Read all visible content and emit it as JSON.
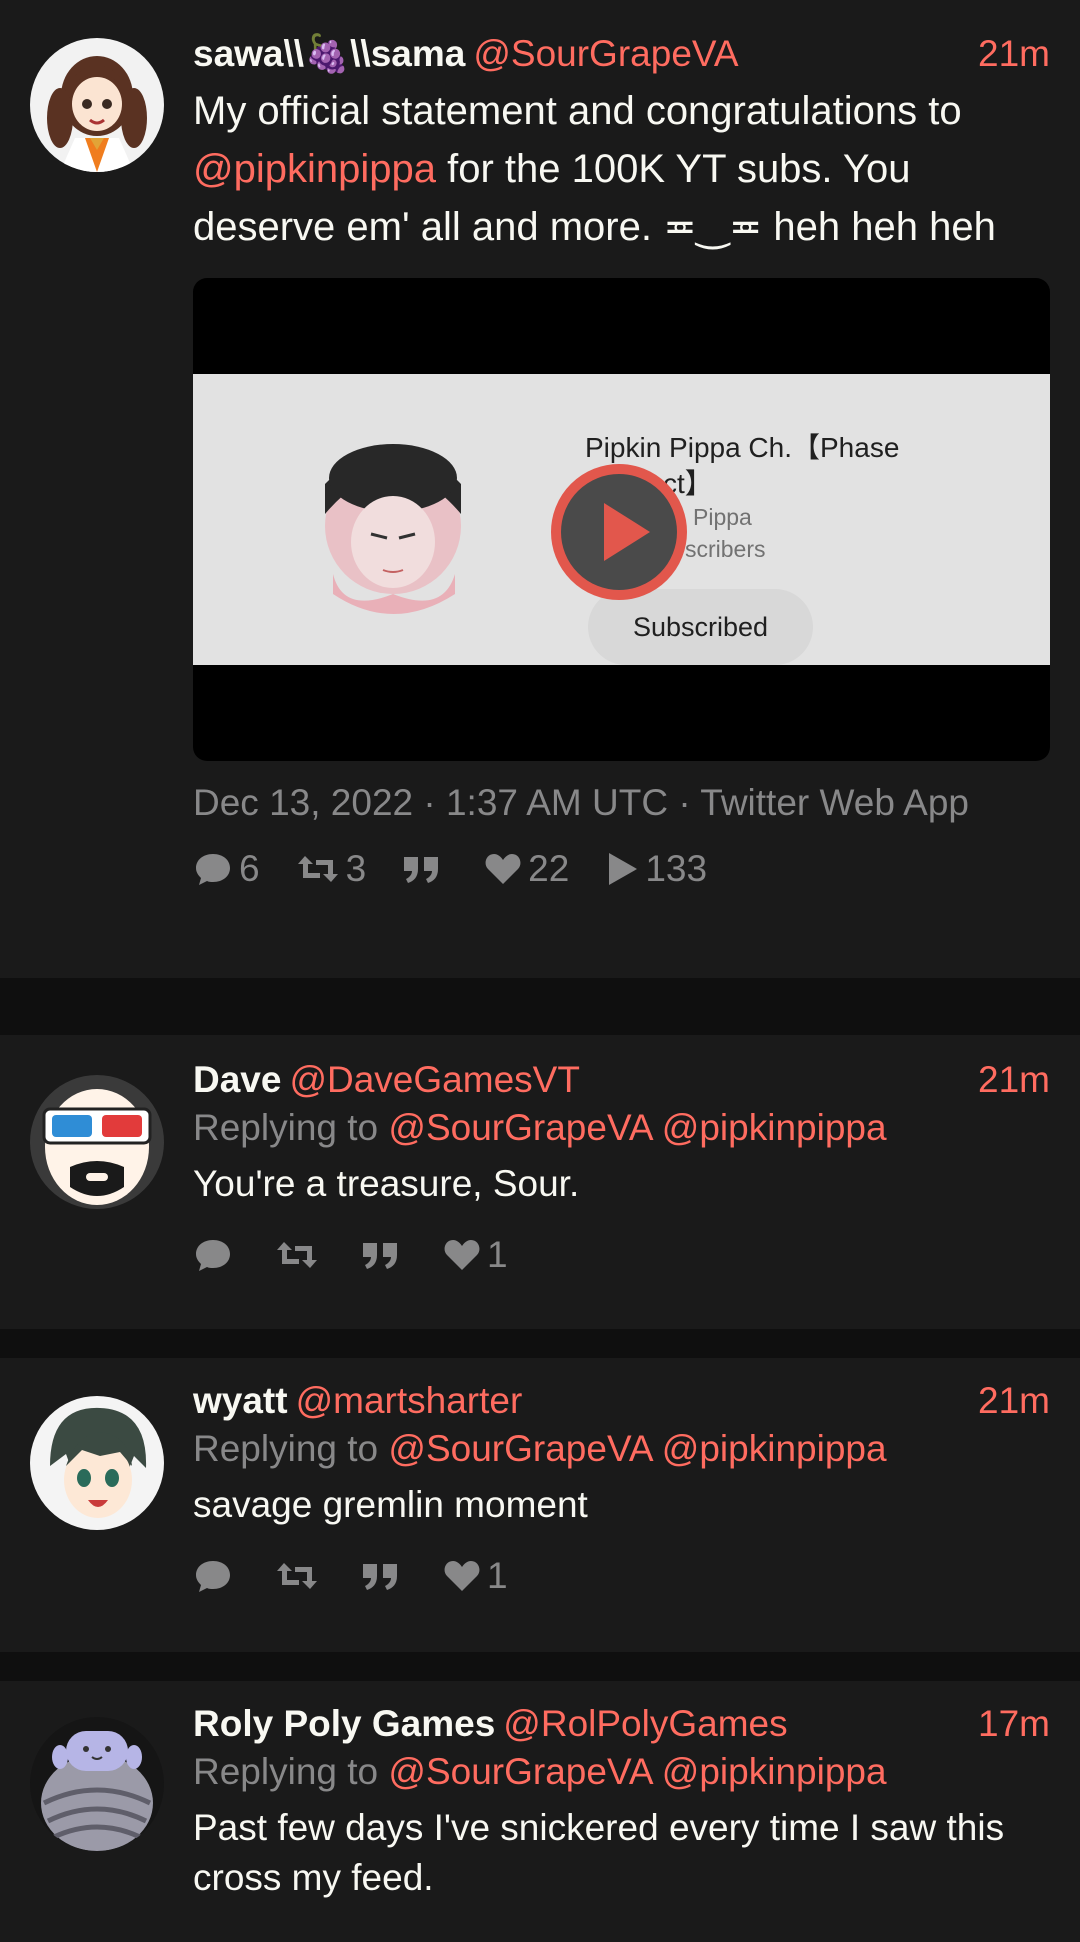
{
  "colors": {
    "background": "#0f0f0f",
    "card": "#1a1a1a",
    "accent": "#ff6c60",
    "muted": "#888889",
    "text": "#f8f8f2"
  },
  "main_tweet": {
    "fullname": "sawa\\\\🍇\\\\sama",
    "username": "@SourGrapeVA",
    "time": "21m",
    "text_before": "My official statement and congratulations to ",
    "mention": "@pipkinpippa",
    "text_after": " for the 100K YT subs. You deserve em' all and more. ≖‿≖ heh heh heh",
    "video": {
      "channel_title_line1": "Pipkin Pippa Ch.【Phase",
      "channel_title_line2": "ct】",
      "channel_handle": "Pippa",
      "channel_subs": "scribers",
      "subscribed_label": "Subscribed",
      "play_icon": "play-icon"
    },
    "date": "Dec 13, 2022 · 1:37 AM UTC · Twitter Web App",
    "stats": {
      "replies": "6",
      "retweets": "3",
      "quotes": "",
      "likes": "22",
      "views": "133"
    }
  },
  "replies": [
    {
      "fullname": "Dave",
      "username": "@DaveGamesVT",
      "time": "21m",
      "replying_label": "Replying to",
      "replying_to": [
        "@SourGrapeVA",
        "@pipkinpippa"
      ],
      "text": "You're a treasure, Sour.",
      "stats": {
        "replies": "",
        "retweets": "",
        "quotes": "",
        "likes": "1"
      }
    },
    {
      "fullname": "wyatt",
      "username": "@martsharter",
      "time": "21m",
      "replying_label": "Replying to",
      "replying_to": [
        "@SourGrapeVA",
        "@pipkinpippa"
      ],
      "text": "savage gremlin moment",
      "stats": {
        "replies": "",
        "retweets": "",
        "quotes": "",
        "likes": "1"
      }
    },
    {
      "fullname": "Roly Poly Games",
      "username": "@RolPolyGames",
      "time": "17m",
      "replying_label": "Replying to",
      "replying_to": [
        "@SourGrapeVA",
        "@pipkinpippa"
      ],
      "text": "Past few days I've snickered every time I saw this cross my feed."
    }
  ]
}
